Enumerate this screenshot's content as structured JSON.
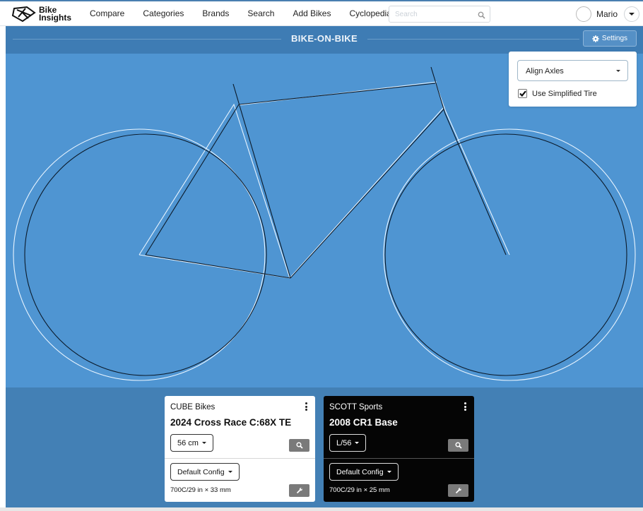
{
  "app": {
    "logo_text_line1": "Bike",
    "logo_text_line2": "Insights"
  },
  "nav": {
    "items": [
      {
        "label": "Compare"
      },
      {
        "label": "Categories"
      },
      {
        "label": "Brands"
      },
      {
        "label": "Search"
      },
      {
        "label": "Add Bikes"
      },
      {
        "label": "Cyclopedia"
      }
    ],
    "search_placeholder": "Search",
    "search_value": "",
    "user_name": "Mario"
  },
  "header": {
    "title": "BIKE-ON-BIKE",
    "settings_label": "Settings"
  },
  "settings": {
    "alignment_selected": "Align Axles",
    "simplified_tire_label": "Use Simplified Tire",
    "simplified_tire_checked": true
  },
  "colors": {
    "canvas_bg": "#4f95d2",
    "bike1_stroke": "#0b1a2a",
    "bike2_stroke": "#e8f4ff",
    "header_bg": "#3e7cb4"
  },
  "bikes": [
    {
      "brand": "CUBE Bikes",
      "model": "2024 Cross Race C:68X TE",
      "size": "56 cm",
      "config": "Default Config",
      "tire": "700C/29 in × 33 mm",
      "theme": "light"
    },
    {
      "brand": "SCOTT Sports",
      "model": "2008 CR1 Base",
      "size": "L/56",
      "config": "Default Config",
      "tire": "700C/29 in × 25 mm",
      "theme": "dark"
    }
  ]
}
